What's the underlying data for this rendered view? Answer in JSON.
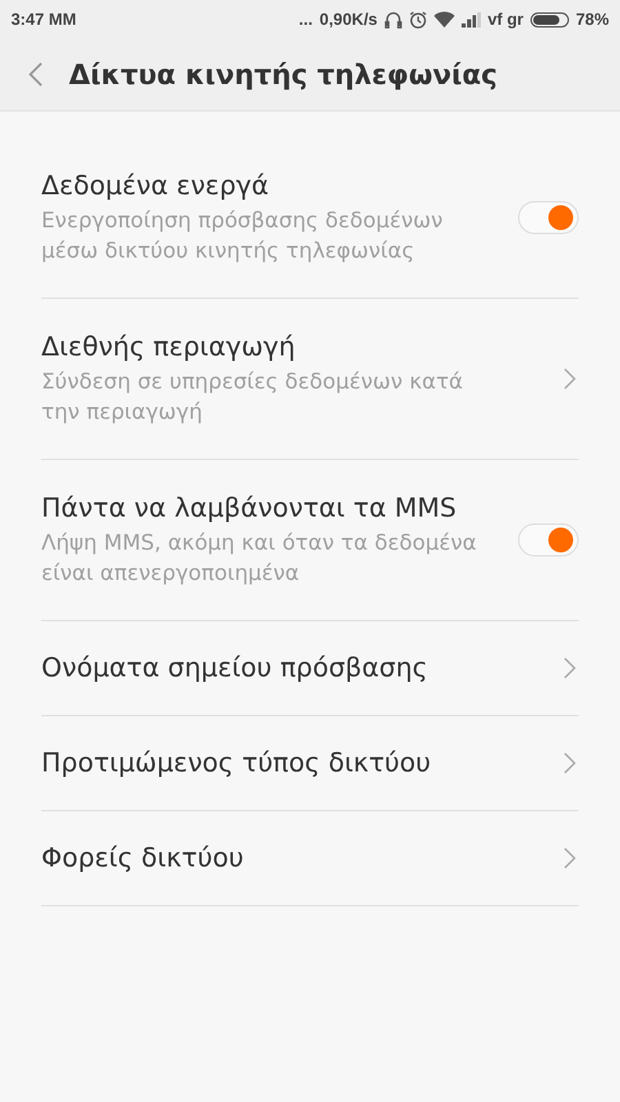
{
  "status_bar": {
    "time": "3:47 MM",
    "dots": "...",
    "speed": "0,90K/s",
    "carrier": "vf gr",
    "battery": "78%",
    "battery_meter": {
      "level": 0.78
    }
  },
  "header": {
    "title": "Δίκτυα κινητής τηλεφωνίας"
  },
  "items": [
    {
      "kind": "toggle",
      "title": "Δεδομένα ενεργά",
      "subtitle": "Ενεργοποίηση πρόσβασης δεδομένων μέσω δικτύου κινητής τηλεφωνίας",
      "on": true
    },
    {
      "kind": "link",
      "title": "Διεθνής περιαγωγή",
      "subtitle": "Σύνδεση σε υπηρεσίες δεδομένων κατά την περιαγωγή"
    },
    {
      "kind": "toggle",
      "title": "Πάντα να λαμβάνονται τα MMS",
      "subtitle": "Λήψη MMS, ακόμη και όταν τα δεδομένα είναι απενεργοποιημένα",
      "on": true
    },
    {
      "kind": "link",
      "title": "Ονόματα σημείου πρόσβασης"
    },
    {
      "kind": "link",
      "title": "Προτιμώμενος τύπος δικτύου"
    },
    {
      "kind": "link",
      "title": "Φορείς δικτύου"
    }
  ]
}
